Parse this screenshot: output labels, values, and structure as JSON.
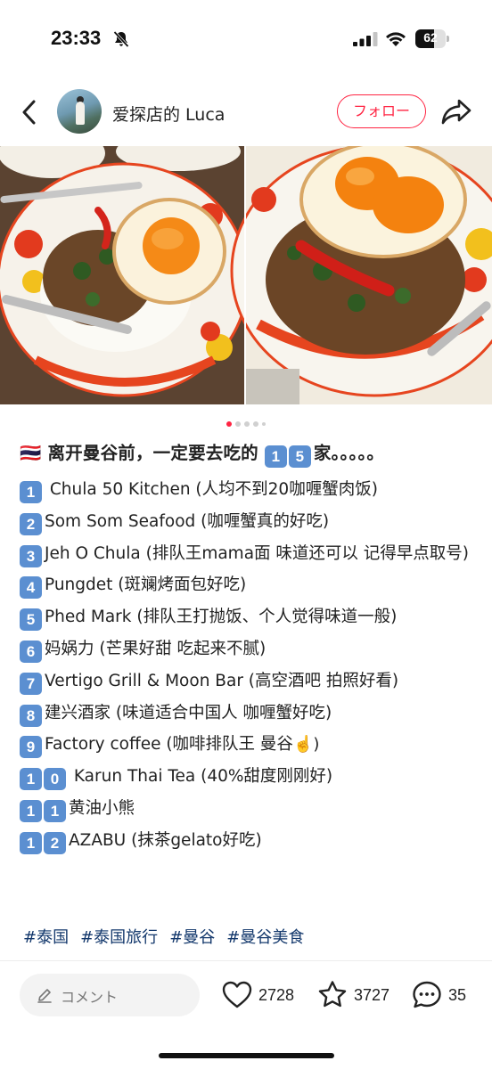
{
  "status_bar": {
    "time": "23:33",
    "battery_level": 62,
    "battery_text": "62",
    "icons": [
      "bell-slash-icon",
      "cellular-signal-icon",
      "wifi-icon",
      "battery-icon"
    ]
  },
  "header": {
    "username": "爱探店的 Luca",
    "follow_label": "フォロー",
    "icons": [
      "chevron-left-icon",
      "share-icon"
    ]
  },
  "carousel": {
    "current_index": 1,
    "total_dots": 5
  },
  "post": {
    "title": "🇹🇭 离开曼谷前，一定要去吃的 1️⃣ 5️⃣ 家。。。。。",
    "title_flag": "🇹🇭",
    "title_text_1": "离开曼谷前，一定要去吃的",
    "title_num_1": "1",
    "title_num_2": "5",
    "title_text_2": "家。。。。。",
    "items": [
      {
        "num": [
          "1"
        ],
        "text": " Chula 50 Kitchen (人均不到20咖喱蟹肉饭)"
      },
      {
        "num": [
          "2"
        ],
        "text": "Som Som Seafood (咖喱蟹真的好吃)"
      },
      {
        "num": [
          "3"
        ],
        "text": "Jeh O Chula (排队王mama面 味道还可以 记得早点取号)"
      },
      {
        "num": [
          "4"
        ],
        "text": "Pungdet (斑斓烤面包好吃)"
      },
      {
        "num": [
          "5"
        ],
        "text": "Phed Mark (排队王打抛饭、个人觉得味道一般)"
      },
      {
        "num": [
          "6"
        ],
        "text": "妈娲力 (芒果好甜 吃起来不腻)"
      },
      {
        "num": [
          "7"
        ],
        "text": "Vertigo Grill & Moon Bar (高空酒吧 拍照好看)"
      },
      {
        "num": [
          "8"
        ],
        "text": "建兴酒家 (味道适合中国人 咖喱蟹好吃)"
      },
      {
        "num": [
          "9"
        ],
        "text": "Factory coffee (咖啡排队王 曼谷",
        "suffix": "☝️)"
      },
      {
        "num": [
          "1",
          "0"
        ],
        "text": " Karun Thai Tea (40%甜度刚刚好)"
      },
      {
        "num": [
          "1",
          "1"
        ],
        "text": "黄油小熊"
      },
      {
        "num": [
          "1",
          "2"
        ],
        "text": "AZABU (抹茶gelato好吃)"
      }
    ],
    "tags": [
      "#泰国",
      "#泰国旅行",
      "#曼谷",
      "#曼谷美食"
    ]
  },
  "bottom_bar": {
    "comment_placeholder": "コメント",
    "likes": "2728",
    "collects": "3727",
    "comments": "35",
    "icons": [
      "pencil-icon",
      "heart-icon",
      "star-icon",
      "comment-bubble-icon"
    ]
  },
  "colors": {
    "accent": "#ff2442",
    "tag": "#13386c",
    "keycap": "#5b8fd1"
  }
}
